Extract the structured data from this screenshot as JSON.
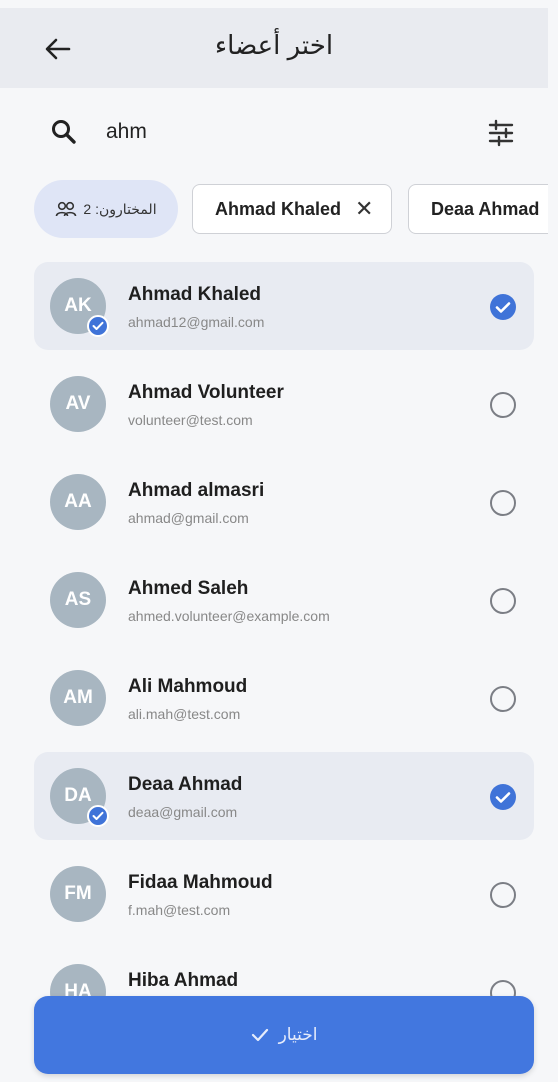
{
  "header": {
    "title": "اختر أعضاء"
  },
  "search": {
    "value": "ahm"
  },
  "selection": {
    "count_label": "المختارون: 2",
    "chips": [
      {
        "label": "Ahmad Khaled"
      },
      {
        "label": "Deaa Ahmad"
      }
    ]
  },
  "members": [
    {
      "initials": "AK",
      "name": "Ahmad Khaled",
      "email": "ahmad12@gmail.com",
      "selected": true
    },
    {
      "initials": "AV",
      "name": "Ahmad Volunteer",
      "email": "volunteer@test.com",
      "selected": false
    },
    {
      "initials": "AA",
      "name": "Ahmad almasri",
      "email": "ahmad@gmail.com",
      "selected": false
    },
    {
      "initials": "AS",
      "name": "Ahmed Saleh",
      "email": "ahmed.volunteer@example.com",
      "selected": false
    },
    {
      "initials": "AM",
      "name": "Ali Mahmoud",
      "email": "ali.mah@test.com",
      "selected": false
    },
    {
      "initials": "DA",
      "name": "Deaa Ahmad",
      "email": "deaa@gmail.com",
      "selected": true
    },
    {
      "initials": "FM",
      "name": "Fidaa Mahmoud",
      "email": "f.mah@test.com",
      "selected": false
    },
    {
      "initials": "HA",
      "name": "Hiba Ahmad",
      "email": "",
      "selected": false
    }
  ],
  "footer": {
    "confirm_label": "اختيار"
  },
  "colors": {
    "accent": "#4277df",
    "avatar": "#a8b6c1",
    "selected_row": "#e8ebf2"
  }
}
